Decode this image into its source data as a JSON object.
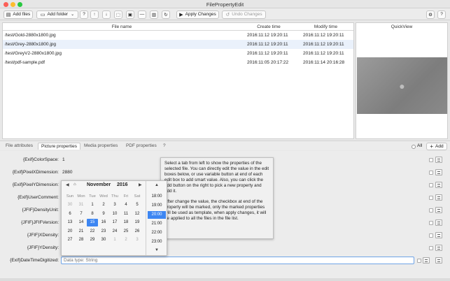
{
  "window": {
    "title": "FilePropertyEdit"
  },
  "toolbar": {
    "add_files": "Add files",
    "add_folder": "Add folder",
    "help": "?",
    "apply_changes": "Apply Changes",
    "undo_changes": "Undo Changes",
    "help2": "?"
  },
  "table": {
    "headers": {
      "name": "File name",
      "create": "Create time",
      "modify": "Modify time"
    },
    "rows": [
      {
        "name": "/test/Gold-2880x1800.jpg",
        "create": "2016:11:12 19:20:11",
        "modify": "2016:11:12 19:20:11"
      },
      {
        "name": "/test/Grey-2880x1800.jpg",
        "create": "2016:11:12 19:20:11",
        "modify": "2016:11:12 19:20:11"
      },
      {
        "name": "/test/GreyV2-2880x1800.jpg",
        "create": "2016:11:12 19:20:11",
        "modify": "2016:11:12 19:20:11"
      },
      {
        "name": "/test/pdf-sample.pdf",
        "create": "2016:11:05 20:17:22",
        "modify": "2016:11:14 20:16:28"
      }
    ]
  },
  "quickview": {
    "title": "QuickView",
    "preview_icon": "apple-logo"
  },
  "tabs": {
    "file": "File attributes",
    "picture": "Picture properties",
    "media": "Media properties",
    "pdf": "PDF properties",
    "help": "?",
    "all": "All",
    "add": "Add"
  },
  "properties": [
    {
      "label": "{Exif}ColorSpace:",
      "value": "1"
    },
    {
      "label": "{Exif}PixelXDimension:",
      "value": "2880"
    },
    {
      "label": "{Exif}PixelYDimension:",
      "value": ""
    },
    {
      "label": "{Exif}UserComment:",
      "value": ""
    },
    {
      "label": "{JFIF}DensityUnit:",
      "value": ""
    },
    {
      "label": "{JFIF}JFIFVersion:",
      "value": ""
    },
    {
      "label": "{JFIF}XDensity:",
      "value": ""
    },
    {
      "label": "{JFIF}YDensity:",
      "value": ""
    },
    {
      "label": "{Exif}DateTimeDigitized:",
      "value": ""
    }
  ],
  "date_input": {
    "placeholder": "Data type: String"
  },
  "tooltip": {
    "p1": "Select a tab from left to show the properties of the selected file. You can directly edit the value in the edit boxes below, or use variable button at end of each edit box to add smart value. Also, you can click the add button on the right to pick a new property and add it.",
    "p2": "After change the value, the checkbox at end of the property will be marked, only the marked properties will be used as template, when apply changes, it will be applied to all the files in the file list."
  },
  "calendar": {
    "month": "November",
    "year": "2016",
    "weekdays": [
      "Sun",
      "Mon",
      "Tue",
      "Wed",
      "Thu",
      "Fri",
      "Sat"
    ],
    "weeks": [
      [
        "30",
        "31",
        "1",
        "2",
        "3",
        "4",
        "5"
      ],
      [
        "6",
        "7",
        "8",
        "9",
        "10",
        "11",
        "12"
      ],
      [
        "13",
        "14",
        "15",
        "16",
        "17",
        "18",
        "19"
      ],
      [
        "20",
        "21",
        "22",
        "23",
        "24",
        "25",
        "26"
      ],
      [
        "27",
        "28",
        "29",
        "30",
        "1",
        "2",
        "3"
      ]
    ],
    "selected_day": "15",
    "times": [
      "18:00",
      "19:00",
      "20:00",
      "21:00",
      "22:00",
      "23:00"
    ],
    "selected_time": "20:00"
  }
}
